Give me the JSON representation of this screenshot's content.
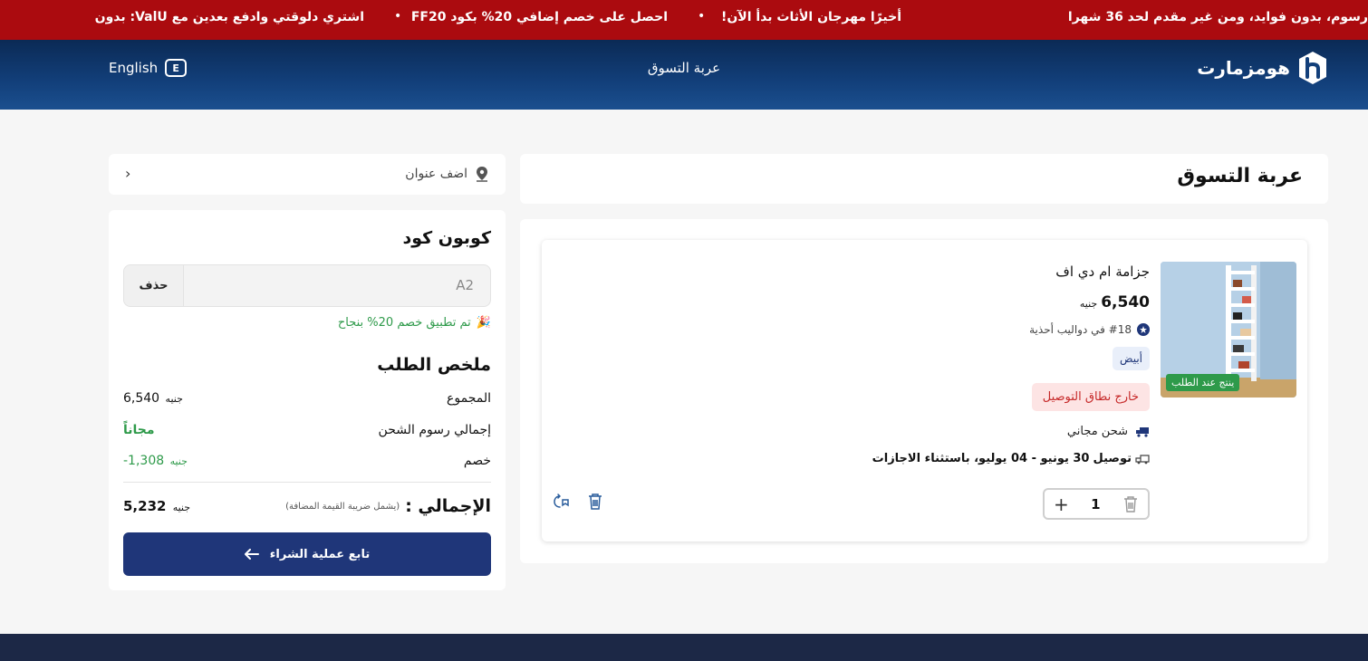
{
  "promo": {
    "item1": "رسوم، بدون فوايد، ومن غير مقدم لحد 36 شهرا",
    "item2": "أخيرًا مهرجان الأثاث بدأ الآن!",
    "item3": "احصل على خصم إضافي 20% بكود FF20",
    "item4": "اشتري دلوقتي وادفع بعدين مع ValU: بدون",
    "separator": "•"
  },
  "header": {
    "language": "English",
    "language_icon": "E",
    "title": "عربة التسوق",
    "brand": "هومزمارت",
    "bg_color": "#0b2a55"
  },
  "address": {
    "label": "اضف عنوان",
    "icon": "location-pin-icon"
  },
  "coupon": {
    "title": "كوبون كود",
    "value": "A2",
    "remove_label": "حذف",
    "applied_msg": "تم تطبيق خصم 20% بنجاح",
    "applied_icon": "party-popper-icon"
  },
  "order_summary": {
    "title": "ملخص الطلب",
    "subtotal_label": "المجموع",
    "subtotal_value": "6,540",
    "currency": "جنيه",
    "shipping_label": "إجمالي رسوم الشحن",
    "shipping_value": "مجاناً",
    "discount_label": "خصم",
    "discount_value": "-1,308",
    "total_label": "الإجمالي :",
    "total_note": "(يشمل ضريبة القيمة المضافة)",
    "total_value": "5,232",
    "checkout_label": "تابع عملية الشراء"
  },
  "cart": {
    "title": "عربة التسوق",
    "item": {
      "name": "جزامة ام دي اف",
      "price": "6,540",
      "currency": "جنيه",
      "rank": "#18 في دواليب أحذية",
      "color": "أبيض",
      "badge": "ينتج عند الطلب",
      "out_of_zone": "خارج نطاق التوصيل",
      "shipping": "شحن مجاني",
      "delivery_prefix": "توصيل",
      "delivery": "30 يونيو - 04 يوليو، باستثناء الاجازات",
      "quantity": "1"
    }
  },
  "colors": {
    "promo_bg": "#ab0b0f",
    "checkout_bg": "#1f3679",
    "success": "#2e9a4a",
    "danger": "#c62828",
    "footer_bg": "#1c2846"
  }
}
